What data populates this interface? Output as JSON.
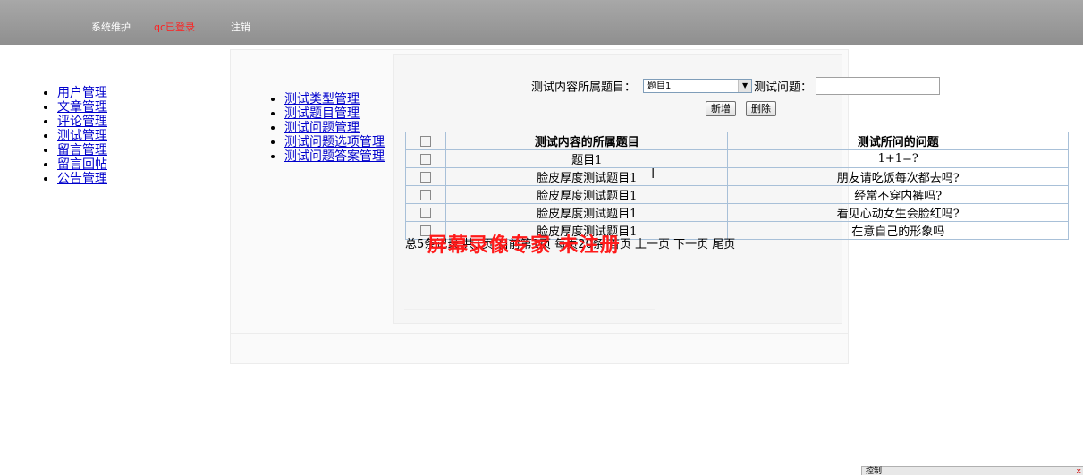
{
  "topbar": {
    "items": [
      "系统维护",
      "qc已登录",
      "注销"
    ]
  },
  "left_menu": [
    "用户管理",
    "文章管理",
    "评论管理",
    "测试管理",
    "留言管理",
    "留言回帖",
    "公告管理"
  ],
  "sub_menu": [
    "测试类型管理",
    "测试题目管理",
    "测试问题管理",
    "测试问题选项管理",
    "测试问题答案管理"
  ],
  "form": {
    "topic_label": "测试内容所属题目：",
    "topic_selected": "题目1",
    "question_label": "测试问题：",
    "question_value": "",
    "add_label": "新增",
    "delete_label": "删除"
  },
  "table": {
    "headers": [
      "测试内容的所属题目",
      "测试所问的问题"
    ],
    "rows": [
      [
        "题目1",
        "1+1=?"
      ],
      [
        "脸皮厚度测试题目1",
        "朋友请吃饭每次都去吗?"
      ],
      [
        "脸皮厚度测试题目1",
        "经常不穿内裤吗?"
      ],
      [
        "脸皮厚度测试题目1",
        "看见心动女生会脸红吗?"
      ],
      [
        "脸皮厚度测试题目1",
        "在意自己的形象吗"
      ]
    ]
  },
  "pager": {
    "text": "总5条记录 共1页 当前第1页 每页20条 首页 上一页 下一页 ",
    "last": "尾页"
  },
  "watermark": "屏幕录像专家 未注册",
  "ctrl": {
    "label": "控制",
    "close": "x"
  },
  "colors": {
    "topbar": "#999999",
    "status_red": "#ff2020",
    "link": "#0000cc",
    "table_border": "#a8c0d8"
  }
}
